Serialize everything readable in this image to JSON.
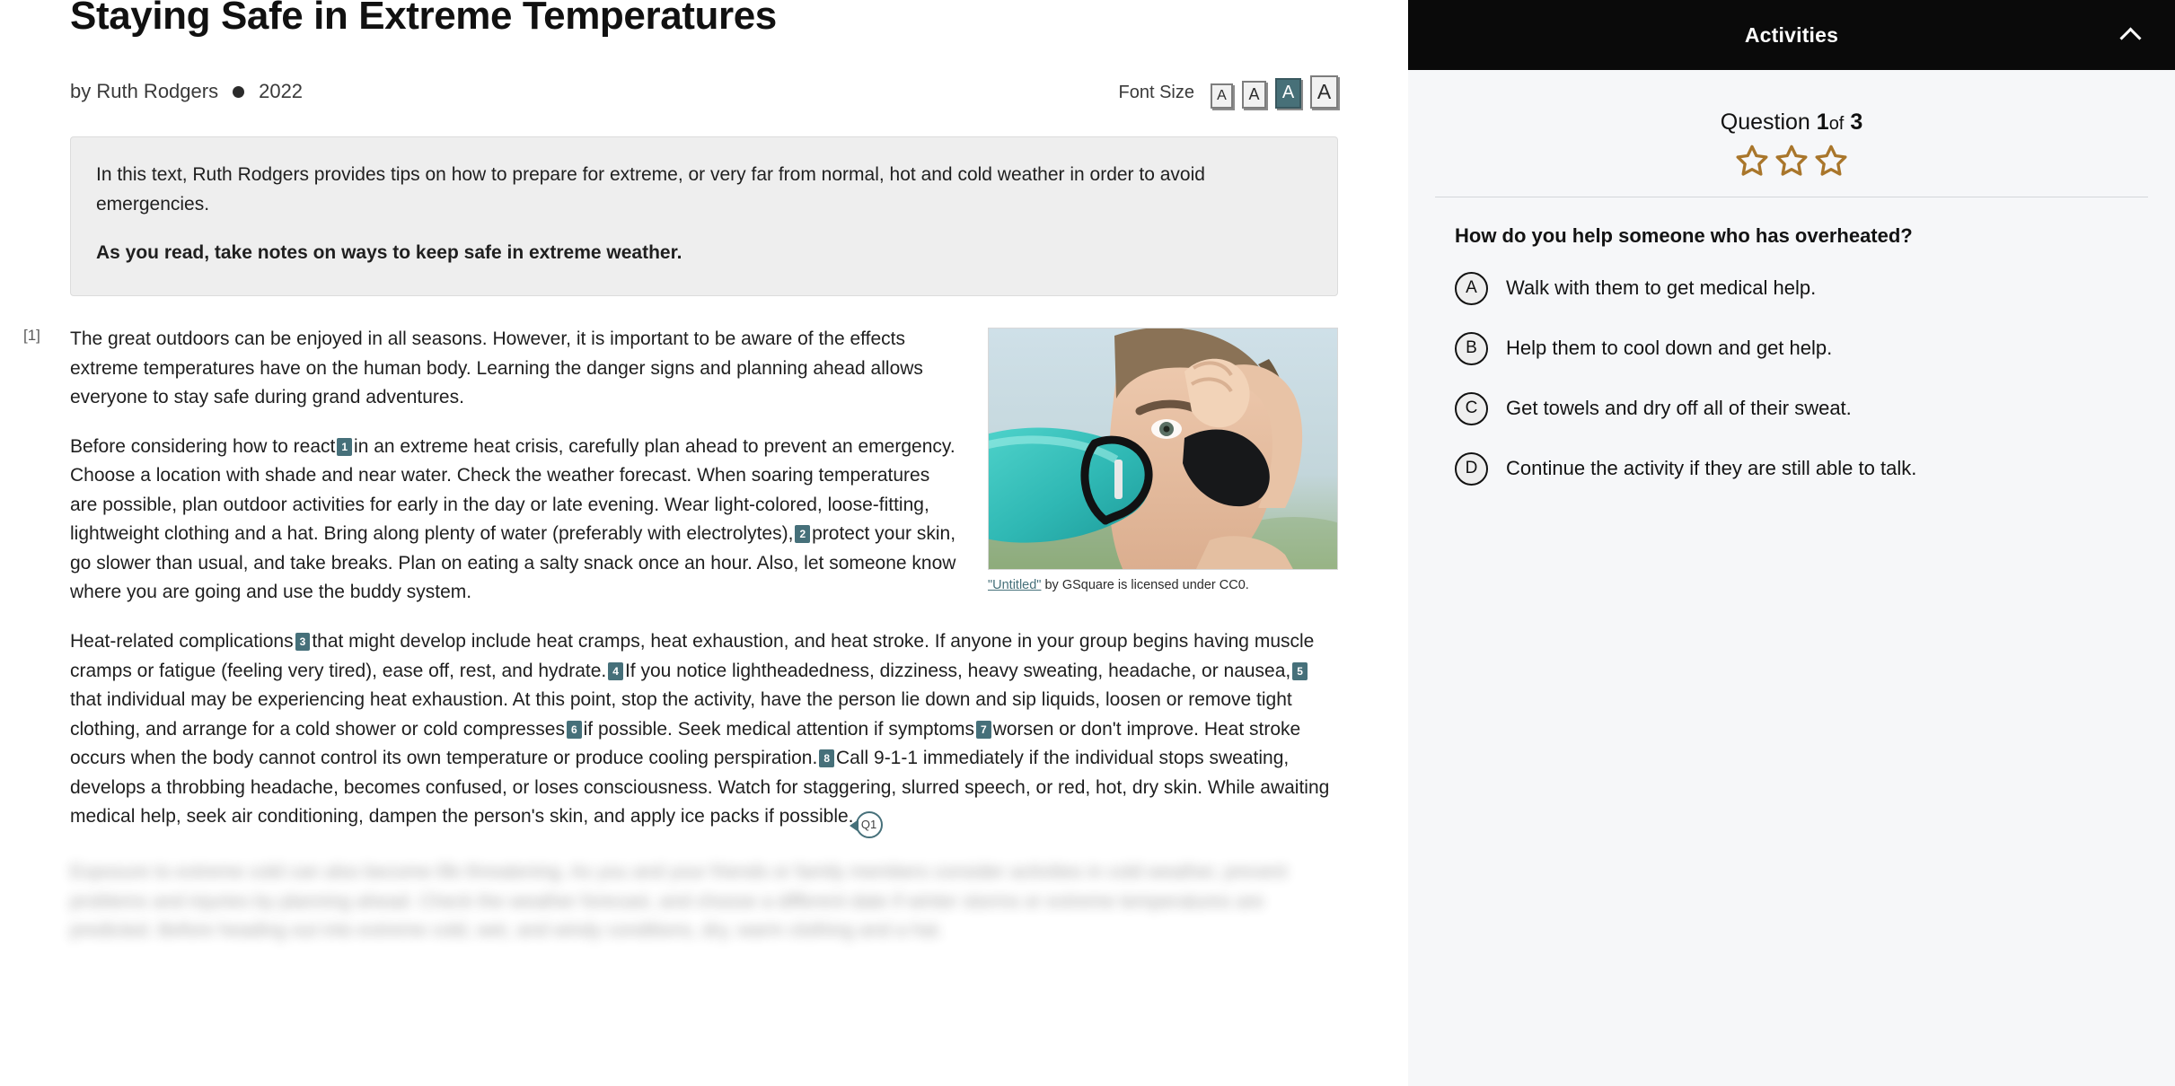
{
  "article": {
    "title": "Staying Safe in Extreme Temperatures",
    "byline_prefix": "by Ruth Rodgers",
    "year": "2022",
    "font_size_label": "Font Size",
    "font_size_options": [
      "A",
      "A",
      "A",
      "A"
    ],
    "font_size_selected_index": 2,
    "intro": {
      "line1": "In this text, Ruth Rodgers provides tips on how to prepare for extreme, or very far from normal, hot and cold weather in order to avoid emergencies.",
      "line2": "As you read, take notes on ways to keep safe in extreme weather."
    },
    "paragraph_number": "[1]",
    "p1": "The great outdoors can be enjoyed in all seasons. However, it is important to be aware of the effects extreme temperatures have on the human body. Learning the danger signs and planning ahead allows everyone to stay safe during grand adventures.",
    "p2_a": "Before considering how to react",
    "p2_fn1": "1",
    "p2_b": "in an extreme heat crisis, carefully plan ahead to prevent an emergency. Choose a location with shade and near water. Check the weather forecast. When soaring temperatures are possible, plan outdoor activities for early in the day or late evening. Wear light-colored, loose-fitting, lightweight clothing and a hat. Bring along plenty of water (preferably with electrolytes),",
    "p2_fn2": "2",
    "p2_c": "protect your skin, go slower than usual, and take breaks. Plan on eating a salty snack once an hour. Also, let someone know where you are going and use the buddy system.",
    "p3_a": "Heat-related complications",
    "p3_fn3": "3",
    "p3_b": "that might develop include heat cramps, heat exhaustion, and heat stroke. If anyone in your group begins having muscle cramps or fatigue (feeling very tired), ease off, rest, and hydrate.",
    "p3_fn4": "4",
    "p3_c": "If you notice lightheadedness, dizziness, heavy sweating, headache, or nausea,",
    "p3_fn5": "5",
    "p3_d": "that individual may be experiencing heat exhaustion. At this point, stop the activity, have the person lie down and sip liquids, loosen or remove tight clothing, and arrange for a cold shower or cold compresses",
    "p3_fn6": "6",
    "p3_e": "if possible. Seek medical attention if symptoms",
    "p3_fn7": "7",
    "p3_f": "worsen or don't improve. Heat stroke occurs when the body cannot control its own temperature or produce cooling perspiration.",
    "p3_fn8": "8",
    "p3_g": "Call 9-1-1 immediately if the individual stops sweating, develops a throbbing headache, becomes confused, or loses consciousness. Watch for staggering, slurred speech, or red, hot, dry skin. While awaiting medical help, seek air conditioning, dampen the person's skin, and apply ice packs if possible.",
    "question_marker": "Q1",
    "p4_faded": "Exposure to extreme cold can also become life threatening. As you and your friends or family members consider activities in cold weather, prevent problems and injuries by planning ahead. Check the weather forecast, and choose a different date if winter storms or extreme temperatures are predicted. Before heading out into extreme cold, wet, and windy conditions, dry, warm clothing and a hat."
  },
  "figure": {
    "caption_link": "\"Untitled\"",
    "caption_rest": " by GSquare is licensed under CC0.",
    "alt": "boy-drinking-water-photo"
  },
  "activities": {
    "header_title": "Activities",
    "collapse_icon": "chevron-up-icon",
    "question_counter_prefix": "Question",
    "question_number": "1",
    "question_of": "of",
    "question_total": "3",
    "stars": 3,
    "star_color": "#a9762b",
    "question_text": "How do you help someone who has overheated?",
    "options": [
      {
        "letter": "A",
        "label": "Walk with them to get medical help."
      },
      {
        "letter": "B",
        "label": "Help them to cool down and get help."
      },
      {
        "letter": "C",
        "label": "Get towels and dry off all of their sweat."
      },
      {
        "letter": "D",
        "label": "Continue the activity if they are still able to talk."
      }
    ]
  },
  "colors": {
    "accent_teal": "#46707a",
    "header_black": "#0a0a0a",
    "panel_bg": "#f6f7f9",
    "intro_bg": "#eeeeee"
  }
}
